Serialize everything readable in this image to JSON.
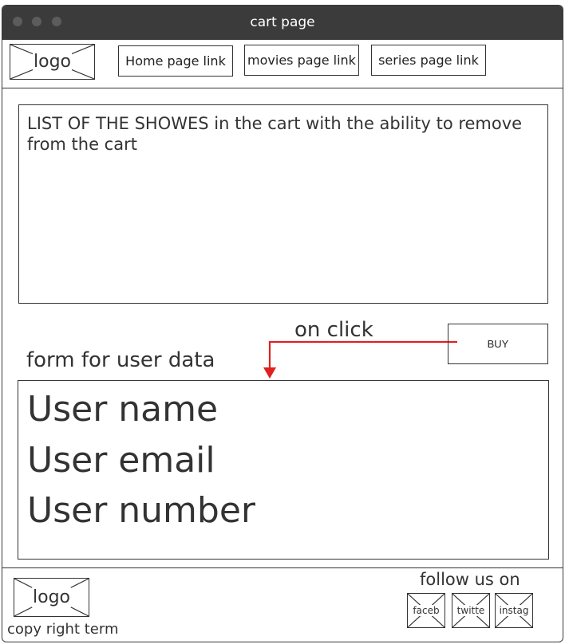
{
  "window": {
    "title": "cart page"
  },
  "header": {
    "logo": "logo",
    "nav": {
      "home": "Home page link",
      "movies": "movies page link",
      "series": "series page link"
    }
  },
  "cart": {
    "list_text": "LIST OF THE SHOWES in the cart with the ability to remove from the cart"
  },
  "annotation": {
    "on_click": "on click",
    "arrow_color": "#e02020"
  },
  "buy": {
    "label": "BUY"
  },
  "form": {
    "label": "form for user data",
    "fields": [
      "User name",
      "User email",
      "User number"
    ]
  },
  "footer": {
    "logo": "logo",
    "copyright": "copy right term",
    "follow": "follow us on",
    "social": [
      "faceb",
      "twitte",
      "instag"
    ]
  }
}
